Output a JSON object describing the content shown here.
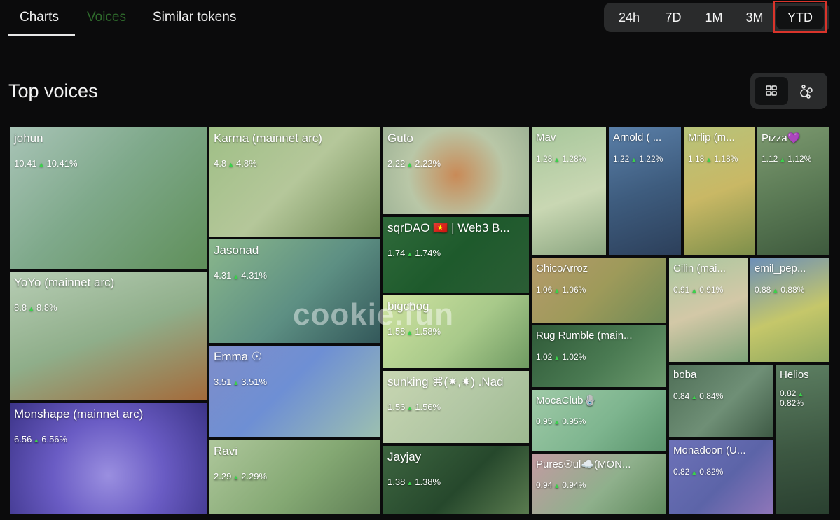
{
  "tabs": {
    "charts": "Charts",
    "voices": "Voices",
    "similar": "Similar tokens"
  },
  "ranges": [
    "24h",
    "7D",
    "1M",
    "3M",
    "YTD"
  ],
  "active_range": "YTD",
  "section_title": "Top voices",
  "view_toggle": {
    "grid_icon": "grid-icon",
    "bubble_icon": "bubble-chart-icon"
  },
  "watermark": "cookie.fun",
  "accent_up": "#3bd14b",
  "voices": [
    {
      "name": "johun",
      "score": "10.41",
      "pct": "10.41%"
    },
    {
      "name": "YoYo (mainnet arc)",
      "score": "8.8",
      "pct": "8.8%"
    },
    {
      "name": "Monshape (mainnet arc)",
      "score": "6.56",
      "pct": "6.56%"
    },
    {
      "name": "Karma (mainnet arc)",
      "score": "4.8",
      "pct": "4.8%"
    },
    {
      "name": "Jasonad",
      "score": "4.31",
      "pct": "4.31%"
    },
    {
      "name": "Emma ☉",
      "score": "3.51",
      "pct": "3.51%"
    },
    {
      "name": "Ravi",
      "score": "2.29",
      "pct": "2.29%"
    },
    {
      "name": "Guto",
      "score": "2.22",
      "pct": "2.22%"
    },
    {
      "name": "sqrDAO 🇻🇳 | Web3 B...",
      "score": "1.74",
      "pct": "1.74%"
    },
    {
      "name": "bigchog",
      "score": "1.58",
      "pct": "1.58%"
    },
    {
      "name": "sunking ⌘(✷,✷)  .Nad",
      "score": "1.56",
      "pct": "1.56%"
    },
    {
      "name": "Jayjay",
      "score": "1.38",
      "pct": "1.38%"
    },
    {
      "name": "Mav",
      "score": "1.28",
      "pct": "1.28%"
    },
    {
      "name": "Arnold ( ...",
      "score": "1.22",
      "pct": "1.22%"
    },
    {
      "name": "Mrlip (m...",
      "score": "1.18",
      "pct": "1.18%"
    },
    {
      "name": "Pizza💜",
      "score": "1.12",
      "pct": "1.12%"
    },
    {
      "name": "ChicoArroz",
      "score": "1.06",
      "pct": "1.06%"
    },
    {
      "name": "Rug Rumble (main...",
      "score": "1.02",
      "pct": "1.02%"
    },
    {
      "name": "MocaClub🪬",
      "score": "0.95",
      "pct": "0.95%"
    },
    {
      "name": "Pures☉ul☁️(MON...",
      "score": "0.94",
      "pct": "0.94%"
    },
    {
      "name": "Cilin (mai...",
      "score": "0.91",
      "pct": "0.91%"
    },
    {
      "name": "emil_pep...",
      "score": "0.88",
      "pct": "0.88%"
    },
    {
      "name": "boba",
      "score": "0.84",
      "pct": "0.84%"
    },
    {
      "name": "Helios",
      "score": "0.82",
      "pct": "0.82%"
    },
    {
      "name": "Monadoon (U...",
      "score": "0.82",
      "pct": "0.82%"
    }
  ]
}
